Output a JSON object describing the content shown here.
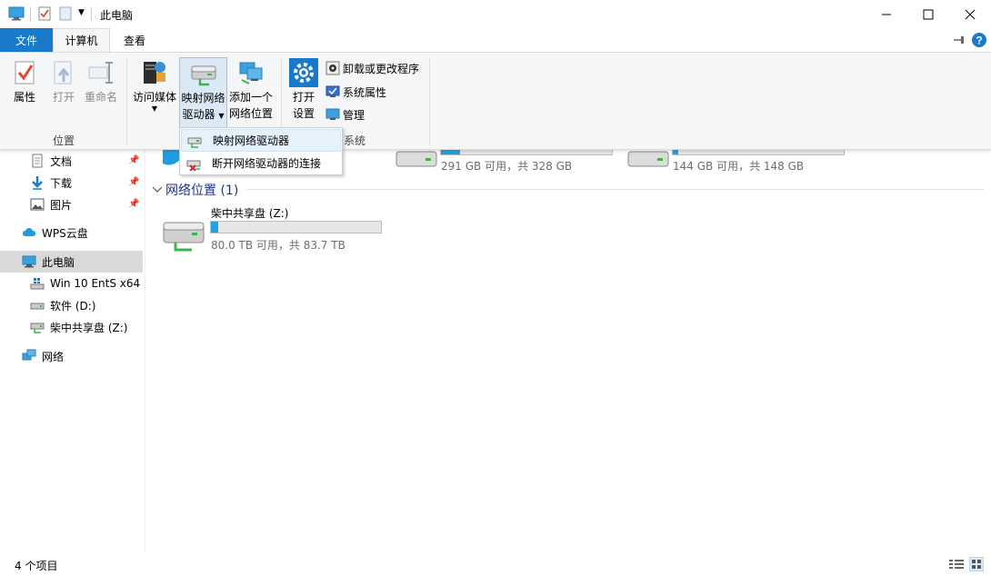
{
  "window": {
    "title": "此电脑",
    "minimize_label": "—",
    "maximize_label": "☐",
    "close_label": "✕"
  },
  "tabs": {
    "file": "文件",
    "computer": "计算机",
    "view": "查看"
  },
  "ribbon": {
    "location_group": {
      "label": "位置",
      "properties": "属性",
      "open": "打开",
      "rename": "重命名"
    },
    "network_group": {
      "access_media": "访问媒体",
      "map_drive_line1": "映射网络",
      "map_drive_line2": "驱动器",
      "add_location_line1": "添加一个",
      "add_location_line2": "网络位置"
    },
    "system_group": {
      "label": "系统",
      "open_settings_line1": "打开",
      "open_settings_line2": "设置",
      "uninstall": "卸载或更改程序",
      "system_properties": "系统属性",
      "manage": "管理"
    }
  },
  "dropdown": {
    "items": [
      {
        "label": "映射网络驱动器"
      },
      {
        "label": "断开网络驱动器的连接"
      }
    ]
  },
  "nav": {
    "items": [
      {
        "label": "文档",
        "pinned": true
      },
      {
        "label": "下载",
        "pinned": true
      },
      {
        "label": "图片",
        "pinned": true
      },
      {
        "label": "WPS云盘"
      },
      {
        "label": "此电脑",
        "selected": true
      },
      {
        "label": "Win 10 EntS x64 ("
      },
      {
        "label": "软件 (D:)"
      },
      {
        "label": "柴中共享盘 (Z:)"
      },
      {
        "label": "网络"
      }
    ]
  },
  "content": {
    "drives": [
      {
        "free_text": "291 GB 可用，共 328 GB",
        "used_fraction": 0.11
      },
      {
        "free_text": "144 GB 可用，共 148 GB",
        "used_fraction": 0.03
      }
    ],
    "network_section": {
      "header": "网络位置 (1)",
      "drive": {
        "name": "柴中共享盘 (Z:)",
        "free_text": "80.0 TB 可用，共 83.7 TB",
        "used_fraction": 0.044
      }
    }
  },
  "status": {
    "item_count": "4 个项目"
  },
  "colors": {
    "file_tab": "#1979ca",
    "drive_bar": "#26a0da",
    "section_header": "#1e3287",
    "selected_nav": "#d9d9d9"
  }
}
